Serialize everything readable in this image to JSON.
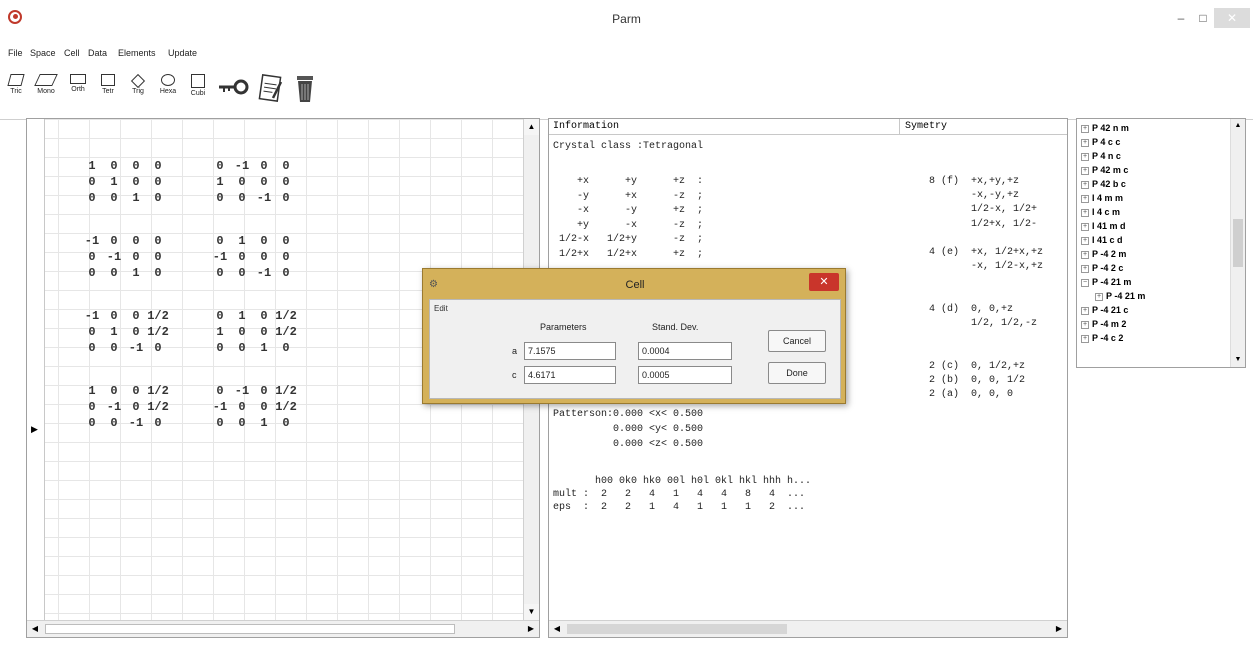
{
  "window": {
    "title": "Parm",
    "minimize": "–",
    "maximize": "□",
    "close": "✕"
  },
  "menu": [
    "File",
    "Space",
    "Cell",
    "Data",
    "Elements",
    "Update"
  ],
  "toolbar": {
    "tools": [
      "Tric",
      "Mono",
      "Orth",
      "Tetr",
      "Trig",
      "Hexa",
      "Cubi"
    ]
  },
  "left_panel": {
    "matrices": [
      {
        "rows": [
          [
            "1",
            "0",
            "0",
            "0",
            "0",
            "-1",
            "0",
            "0"
          ],
          [
            "0",
            "1",
            "0",
            "0",
            "1",
            "0",
            "0",
            "0"
          ],
          [
            "0",
            "0",
            "1",
            "0",
            "0",
            "0",
            "-1",
            "0"
          ]
        ]
      },
      {
        "rows": [
          [
            "-1",
            "0",
            "0",
            "0",
            "0",
            "1",
            "0",
            "0"
          ],
          [
            "0",
            "-1",
            "0",
            "0",
            "-1",
            "0",
            "0",
            "0"
          ],
          [
            "0",
            "0",
            "1",
            "0",
            "0",
            "0",
            "-1",
            "0"
          ]
        ]
      },
      {
        "rows": [
          [
            "-1",
            "0",
            "0",
            "1/2",
            "0",
            "1",
            "0",
            "1/2"
          ],
          [
            "0",
            "1",
            "0",
            "1/2",
            "1",
            "0",
            "0",
            "1/2"
          ],
          [
            "0",
            "0",
            "-1",
            "0",
            "0",
            "0",
            "1",
            "0"
          ]
        ]
      },
      {
        "rows": [
          [
            "1",
            "0",
            "0",
            "1/2",
            "0",
            "-1",
            "0",
            "1/2"
          ],
          [
            "0",
            "-1",
            "0",
            "1/2",
            "-1",
            "0",
            "0",
            "1/2"
          ],
          [
            "0",
            "0",
            "-1",
            "0",
            "0",
            "0",
            "1",
            "0"
          ]
        ]
      }
    ]
  },
  "info_panel": {
    "header_information": "Information",
    "header_symmetry": "Symetry",
    "crystal_class": "Crystal class :Tetragonal",
    "ops_lines": [
      "    +x      +y      +z  :",
      "    -y      +x      -z  ;",
      "    -x      -y      +z  ;",
      "    +y      -x      -z  ;",
      " 1/2-x   1/2+y      -z  ;",
      " 1/2+x   1/2+x      +z  ;"
    ],
    "sym_lines": [
      "8 (f)  +x,+y,+z",
      "       -x,-y,+z",
      "       1/2-x, 1/2+",
      "       1/2+x, 1/2-",
      "",
      "4 (e)  +x, 1/2+x,+z",
      "       -x, 1/2-x,+z",
      "",
      "",
      "4 (d)  0, 0,+z",
      "       1/2, 1/2,-z",
      "",
      "",
      "2 (c)  0, 1/2,+z",
      "2 (b)  0, 0, 1/2",
      "2 (a)  0, 0, 0"
    ],
    "patterson_lines": [
      "Patterson:0.000 <x< 0.500",
      "          0.000 <y< 0.500",
      "          0.000 <z< 0.500"
    ],
    "reflection_header": "       h00 0k0 hk0 00l h0l 0kl hkl hhh h...",
    "mult_line": "mult :  2   2   4   1   4   4   8   4  ...",
    "eps_line": "eps  :  2   2   1   4   1   1   1   2  ..."
  },
  "tree": [
    {
      "sign": "+",
      "label": "P 42 n m"
    },
    {
      "sign": "+",
      "label": "P 4 c c"
    },
    {
      "sign": "+",
      "label": "P 4 n c"
    },
    {
      "sign": "+",
      "label": "P 42 m c"
    },
    {
      "sign": "+",
      "label": "P 42 b c"
    },
    {
      "sign": "+",
      "label": "I 4 m m"
    },
    {
      "sign": "+",
      "label": "I 4 c m"
    },
    {
      "sign": "+",
      "label": "I 41 m d"
    },
    {
      "sign": "+",
      "label": "I 41 c d"
    },
    {
      "sign": "+",
      "label": "P -4 2 m"
    },
    {
      "sign": "+",
      "label": "P -4 2 c"
    },
    {
      "sign": "−",
      "label": "P -4 21 m"
    },
    {
      "sign": "+",
      "label": "P -4 21 m",
      "indent": true
    },
    {
      "sign": "+",
      "label": "P -4 21 c"
    },
    {
      "sign": "+",
      "label": "P -4 m 2"
    },
    {
      "sign": "+",
      "label": "P -4 c 2"
    }
  ],
  "dialog": {
    "title": "Cell",
    "close": "✕",
    "edit_menu": "Edit",
    "col_parameters": "Parameters",
    "col_stddev": "Stand. Dev.",
    "param_a_label": "a",
    "param_a_value": "7.1575",
    "param_a_dev": "0.0004",
    "param_c_label": "c",
    "param_c_value": "4.6171",
    "param_c_dev": "0.0005",
    "cancel_label": "Cancel",
    "done_label": "Done"
  },
  "icons": [
    "app-icon",
    "key-icon",
    "document-icon",
    "trash-icon"
  ]
}
